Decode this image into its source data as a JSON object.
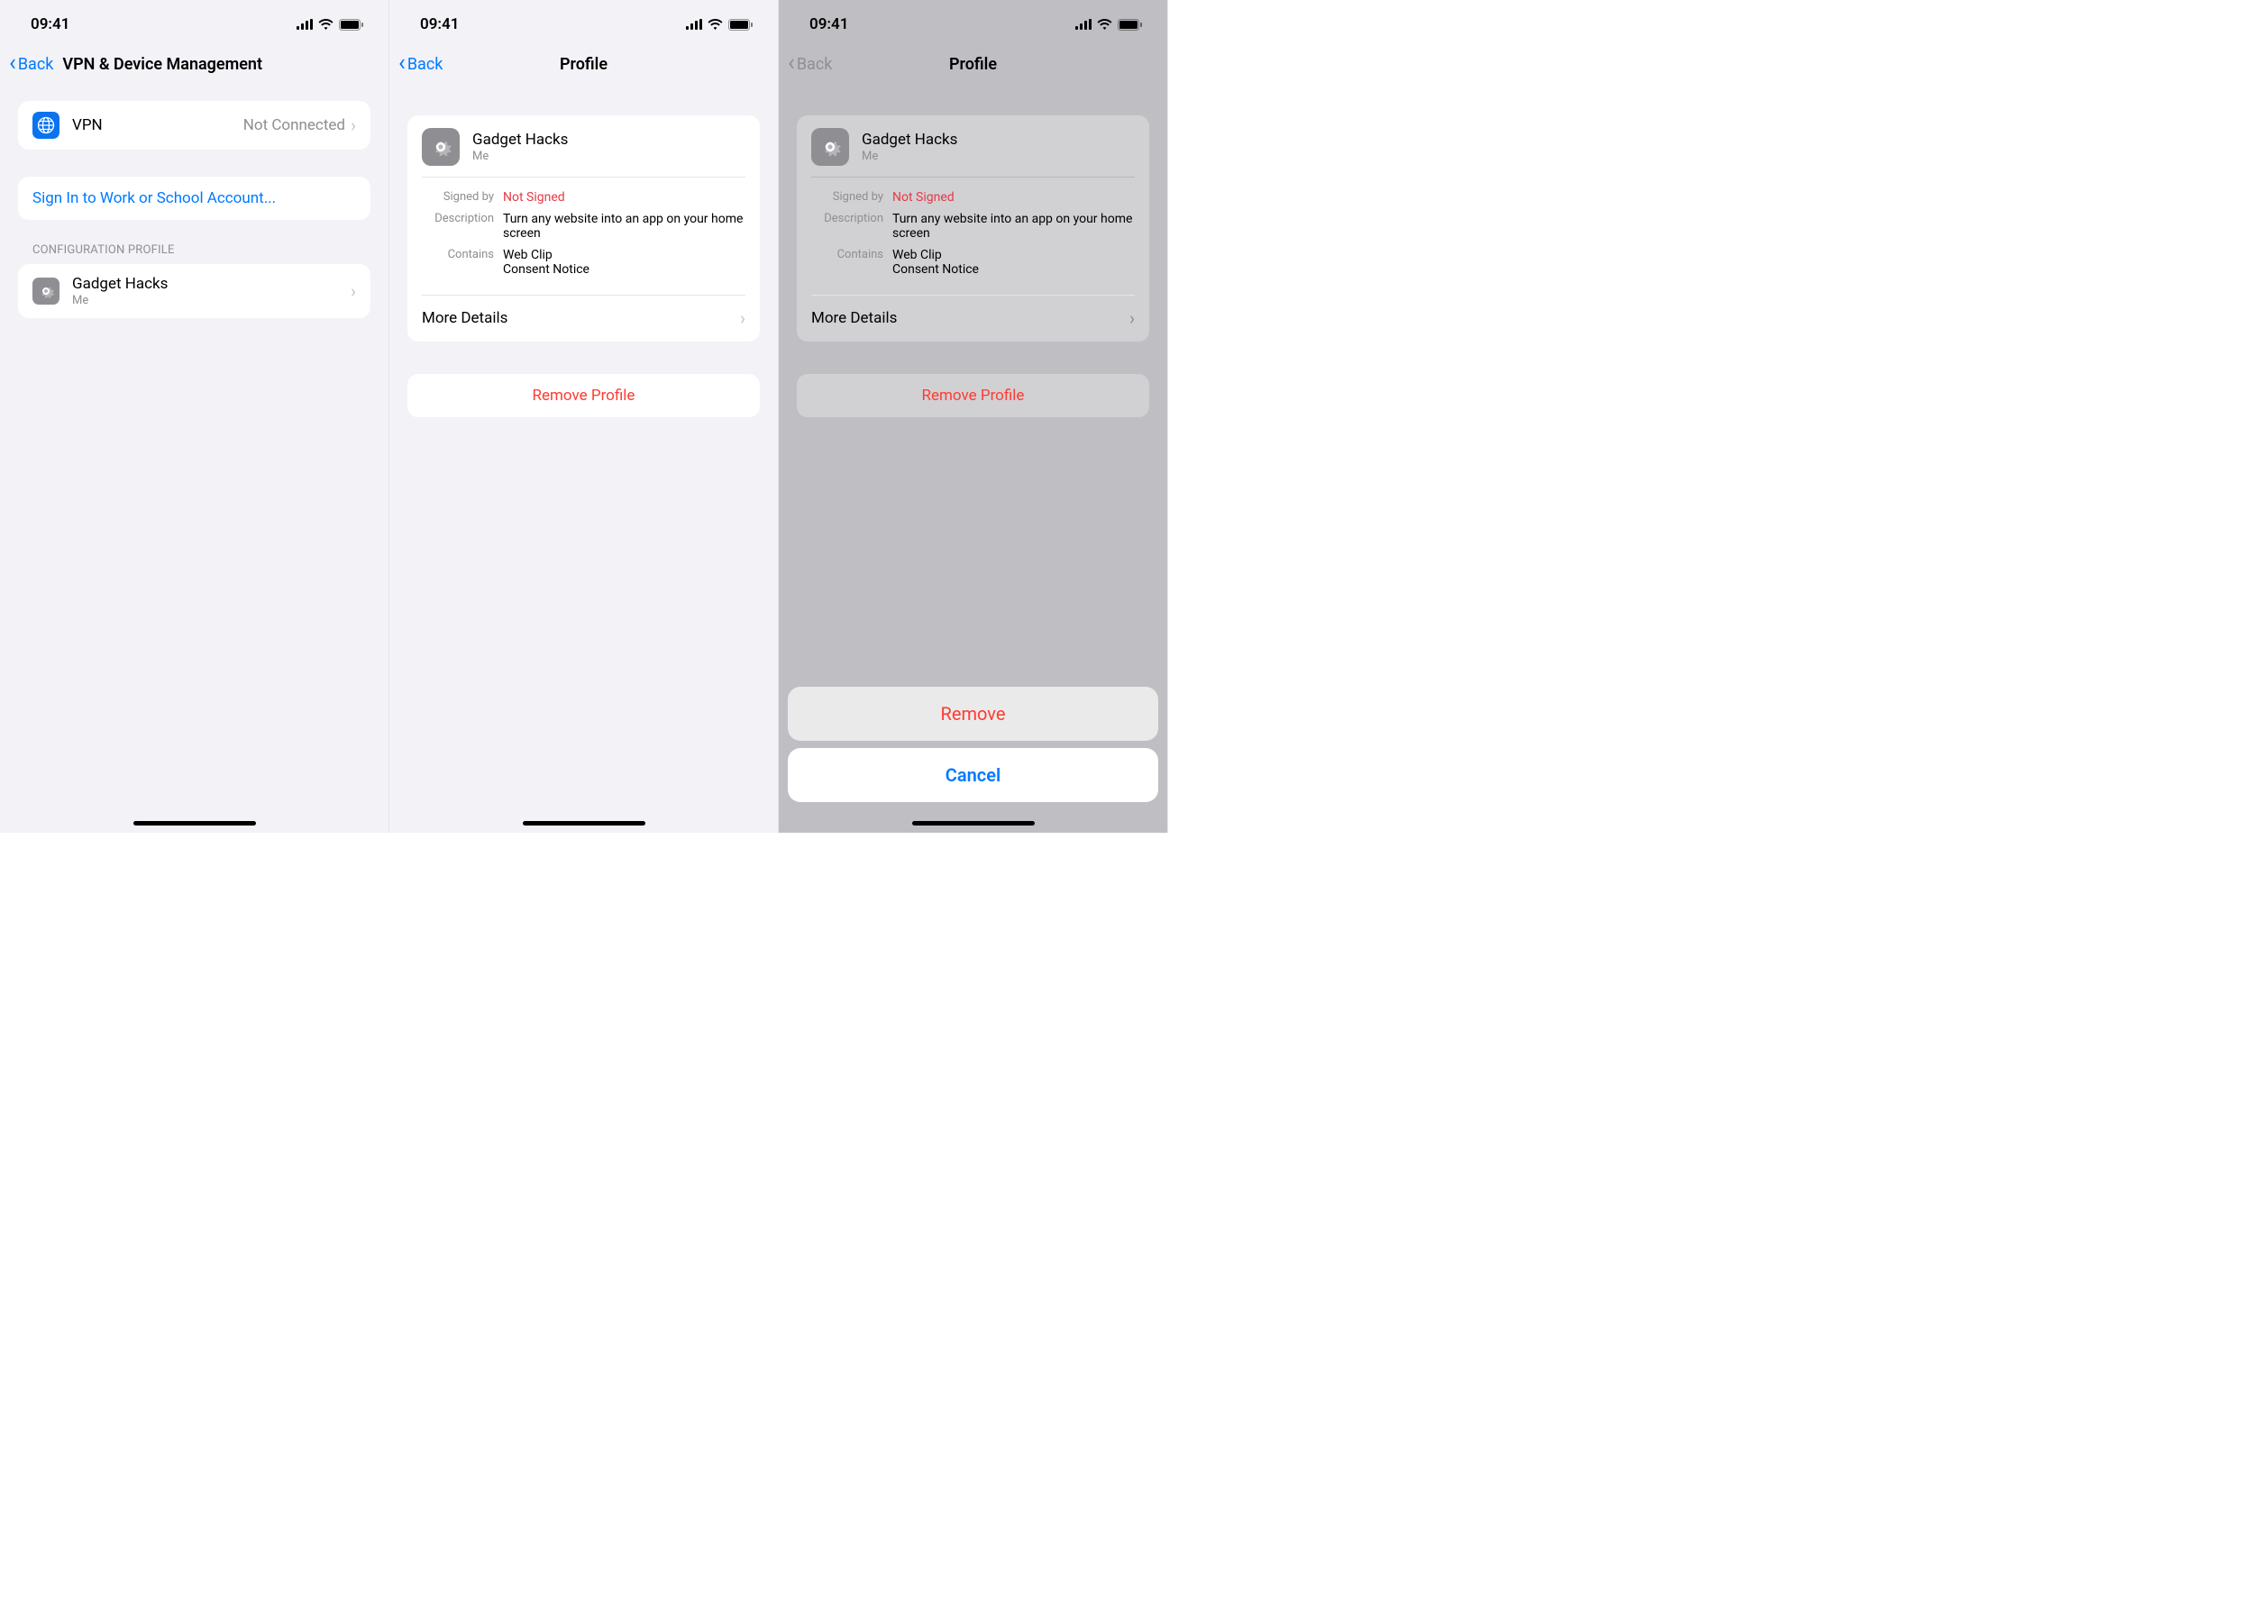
{
  "status": {
    "time": "09:41"
  },
  "screen1": {
    "back": "Back",
    "title": "VPN & Device Management",
    "vpn": {
      "label": "VPN",
      "value": "Not Connected"
    },
    "signin": "Sign In to Work or School Account...",
    "section": "CONFIGURATION PROFILE",
    "profile": {
      "name": "Gadget Hacks",
      "author": "Me"
    }
  },
  "screen2": {
    "back": "Back",
    "title": "Profile",
    "profile": {
      "name": "Gadget Hacks",
      "author": "Me"
    },
    "signed_by_label": "Signed by",
    "signed_by_value": "Not Signed",
    "description_label": "Description",
    "description_value": "Turn any website into an app on your home screen",
    "contains_label": "Contains",
    "contains_value1": "Web Clip",
    "contains_value2": "Consent Notice",
    "more_details": "More Details",
    "remove_profile": "Remove Profile"
  },
  "screen3": {
    "back": "Back",
    "title": "Profile",
    "profile": {
      "name": "Gadget Hacks",
      "author": "Me"
    },
    "signed_by_label": "Signed by",
    "signed_by_value": "Not Signed",
    "description_label": "Description",
    "description_value": "Turn any website into an app on your home screen",
    "contains_label": "Contains",
    "contains_value1": "Web Clip",
    "contains_value2": "Consent Notice",
    "more_details": "More Details",
    "remove_profile": "Remove Profile",
    "sheet": {
      "remove": "Remove",
      "cancel": "Cancel"
    }
  }
}
